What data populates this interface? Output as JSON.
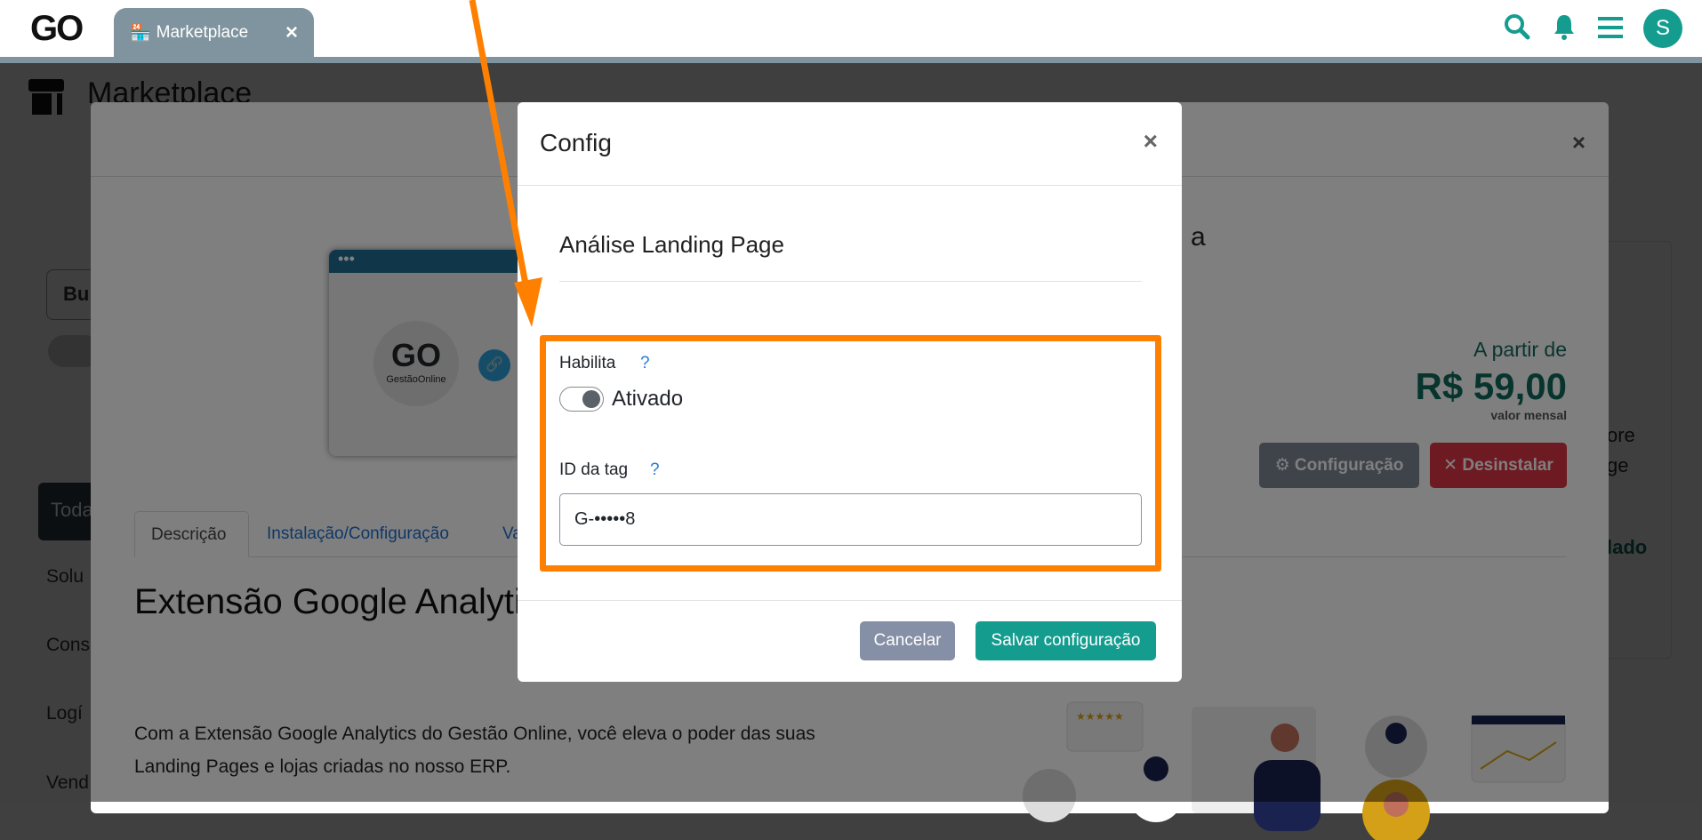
{
  "topbar": {
    "logo": "GO",
    "tab_label": "Marketplace",
    "tab_close": "×",
    "avatar_initial": "S"
  },
  "page": {
    "title": "Marketplace",
    "search_partial": "Bu",
    "filters": [
      "Toda",
      "Solu",
      "Cons",
      "Logí",
      "Vend"
    ],
    "right_snippets": [
      "ore",
      "ge",
      "lado"
    ]
  },
  "product_modal": {
    "close": "×",
    "title_tail": "a",
    "price_prefix": "A partir de",
    "price": "R$ 59,00",
    "price_period": "valor mensal",
    "config_button": "Configuração",
    "uninstall_button": "Desinstalar",
    "tabs": [
      "Descrição",
      "Instalação/Configuração",
      "Va"
    ],
    "heading": "Extensão Google Analytics para Landing Pages",
    "paragraph": [
      "Com a Extensão Google Analytics do Gestão Online, você eleva o poder das suas",
      "Landing Pages e lojas criadas no nosso ERP."
    ],
    "logo_caption": "GestãoOnline"
  },
  "config_modal": {
    "title": "Config",
    "close": "×",
    "section_title": "Análise Landing Page",
    "enable_label": "Habilita",
    "help": "?",
    "toggle_state": "Ativado",
    "toggle_on": true,
    "tag_label": "ID da tag",
    "tag_value": "G-•••••8",
    "cancel": "Cancelar",
    "save": "Salvar configuração"
  },
  "colors": {
    "accent": "#149d8f",
    "cancel": "#858fa5",
    "highlight": "#ff8000",
    "danger": "#dc3545"
  }
}
